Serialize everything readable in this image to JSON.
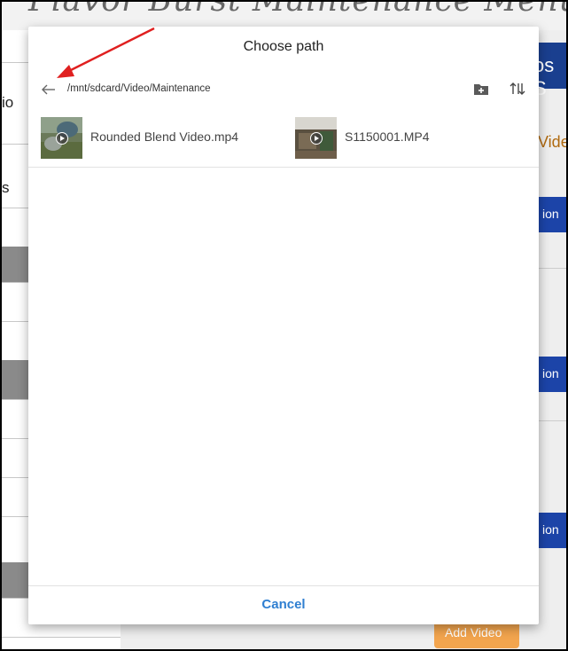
{
  "background_app": {
    "title": "Flavor Burst Maintenance Menu",
    "header_fragment": "os S",
    "video_fragment": "Vide",
    "button_fragment": "ion",
    "left_fragment_1": "io",
    "left_fragment_2": "s",
    "add_video_label": "Add Video",
    "colors": {
      "header": "#1a3f8f",
      "button": "#1c44a8",
      "add_video": "#f3a54e"
    }
  },
  "dialog": {
    "title": "Choose path",
    "back_icon": "arrow-left-icon",
    "path": "/mnt/sdcard/Video/Maintenance",
    "new_folder_icon": "new-folder-icon",
    "sort_icon": "sort-icon",
    "files": [
      {
        "name": "Rounded Blend Video.mp4",
        "icon": "video-thumbnail"
      },
      {
        "name": "S1150001.MP4",
        "icon": "video-thumbnail"
      }
    ],
    "cancel_label": "Cancel",
    "accent_color": "#2f7fd1"
  },
  "annotation": {
    "type": "red-arrow",
    "color": "#e02020",
    "points_to": "back-button"
  }
}
